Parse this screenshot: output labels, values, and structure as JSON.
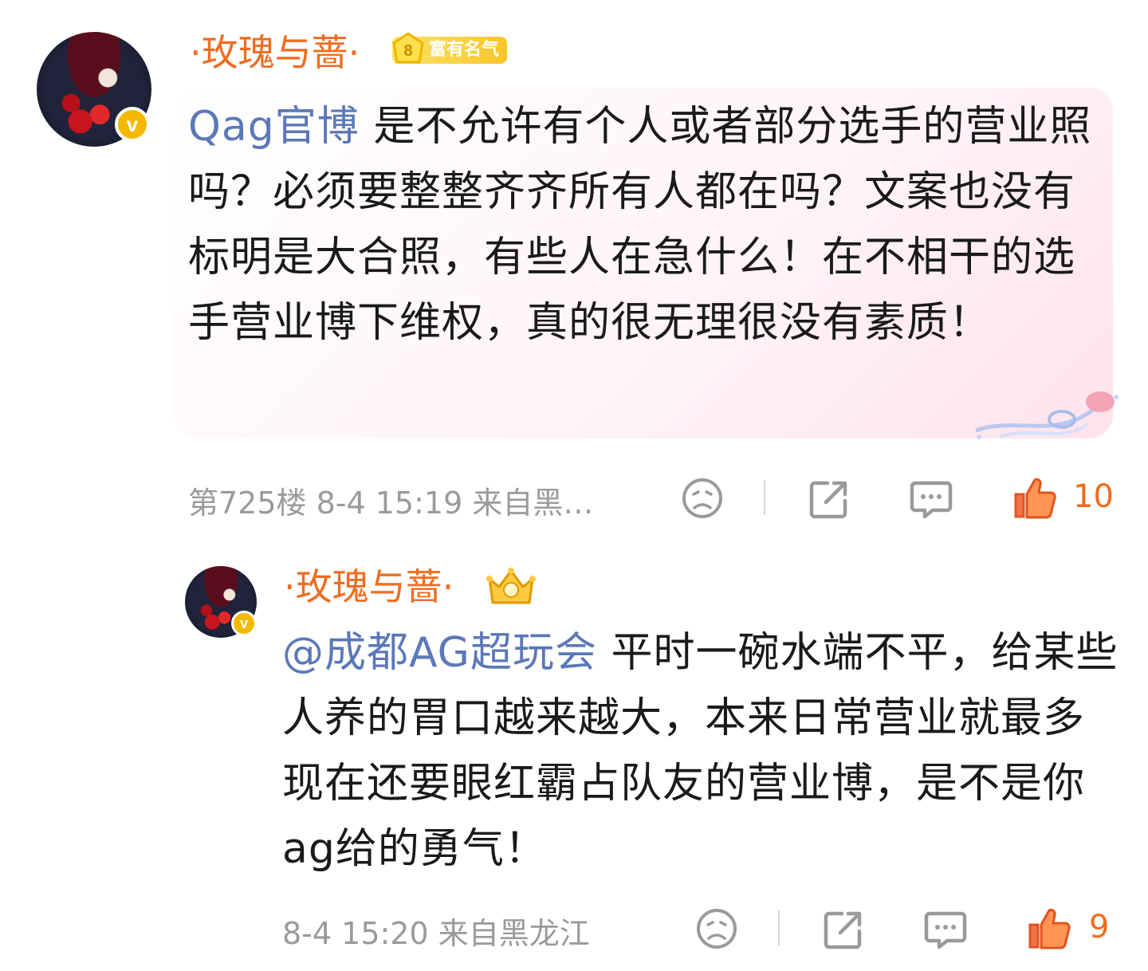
{
  "comments": [
    {
      "username": "·玫瑰与蔷·",
      "badge_text": "富有名气",
      "badge_level": "8",
      "mention": "Qag官博",
      "text": " 是不允许有个人或者部分选手的营业照吗？必须要整整齐齐所有人都在吗？文案也没有标明是大合照，有些人在急什么！在不相干的选手营业博下维权，真的很无理很没有素质！",
      "meta": "第725楼  8-4 15:19  来自黑…",
      "likes": "10"
    },
    {
      "username": "·玫瑰与蔷·",
      "mention": "@成都AG超玩会",
      "text": " 平时一碗水端不平，给某些人养的胃口越来越大，本来日常营业就最多现在还要眼红霸占队友的营业博，是不是你ag给的勇气！",
      "meta": "8-4 15:20  来自黑龙江",
      "likes": "9"
    }
  ],
  "icons": [
    "verified-icon",
    "emoji-react-icon",
    "share-icon",
    "reply-icon",
    "like-icon"
  ],
  "colors": {
    "username": "#ee6d21",
    "mention": "#5b78b8",
    "like": "#ef6c1f",
    "meta": "#9a9a9a",
    "badge": "#f6c628"
  }
}
